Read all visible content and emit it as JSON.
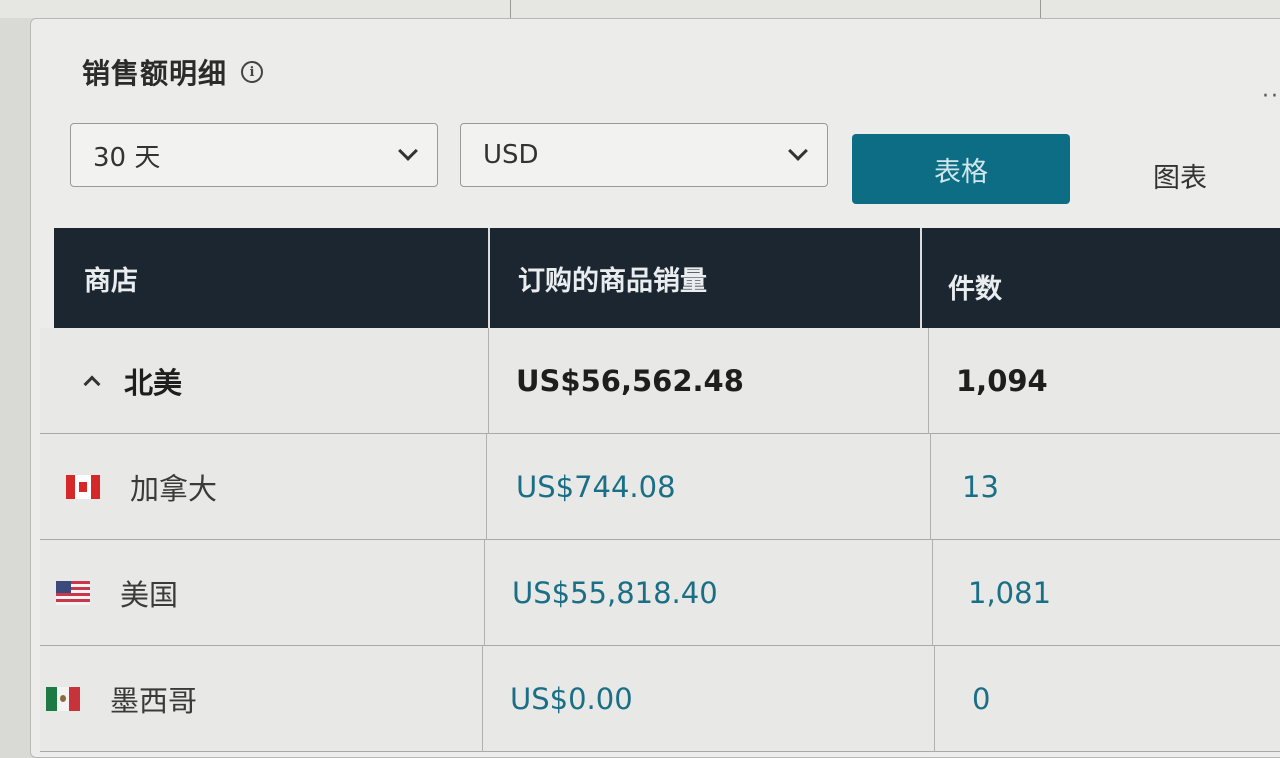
{
  "panel": {
    "title": "销售额明细",
    "info_icon": "ⓘ",
    "more_icon": "···"
  },
  "filters": {
    "period": "30 天",
    "currency": "USD"
  },
  "view_toggle": {
    "table_label": "表格",
    "chart_label": "图表"
  },
  "table": {
    "columns": [
      "商店",
      "订购的商品销量",
      "件数"
    ],
    "group": {
      "name": "北美",
      "sales": "US$56,562.48",
      "units": "1,094"
    },
    "rows": [
      {
        "flag": "canada-flag-icon",
        "store": "加拿大",
        "sales": "US$744.08",
        "units": "13"
      },
      {
        "flag": "usa-flag-icon",
        "store": "美国",
        "sales": "US$55,818.40",
        "units": "1,081"
      },
      {
        "flag": "mexico-flag-icon",
        "store": "墨西哥",
        "sales": "US$0.00",
        "units": "0"
      }
    ]
  },
  "colors": {
    "primary_button": "#0d6d84",
    "header_bg": "#1b2630",
    "link_value": "#1a6f86"
  }
}
